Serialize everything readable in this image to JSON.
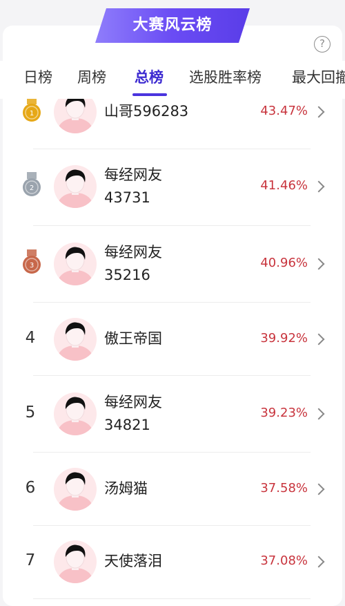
{
  "banner": {
    "title": "大赛风云榜"
  },
  "help": {
    "icon": "?"
  },
  "tabs": [
    {
      "label": "日榜",
      "active": false
    },
    {
      "label": "周榜",
      "active": false
    },
    {
      "label": "总榜",
      "active": true
    },
    {
      "label": "选股胜率榜",
      "active": false
    },
    {
      "label": "最大回撤",
      "active": false
    }
  ],
  "list": [
    {
      "rank": "1",
      "medal": "gold",
      "name_line1": "山哥596283",
      "name_line2": "",
      "pct": "43.47%"
    },
    {
      "rank": "2",
      "medal": "silver",
      "name_line1": "每经网友",
      "name_line2": "43731",
      "pct": "41.46%"
    },
    {
      "rank": "3",
      "medal": "bronze",
      "name_line1": "每经网友",
      "name_line2": "35216",
      "pct": "40.96%"
    },
    {
      "rank": "4",
      "medal": "",
      "name_line1": "傲王帝国",
      "name_line2": "",
      "pct": "39.92%"
    },
    {
      "rank": "5",
      "medal": "",
      "name_line1": "每经网友",
      "name_line2": "34821",
      "pct": "39.23%"
    },
    {
      "rank": "6",
      "medal": "",
      "name_line1": "汤姆猫",
      "name_line2": "",
      "pct": "37.58%"
    },
    {
      "rank": "7",
      "medal": "",
      "name_line1": "天使落泪",
      "name_line2": "",
      "pct": "37.08%"
    }
  ],
  "colors": {
    "accent": "#3d2bd1",
    "percent": "#c8343d",
    "avatar_bg": "#fde8ea",
    "gold": "#e6a817",
    "silver": "#9aa3ad",
    "bronze": "#c7674a"
  }
}
